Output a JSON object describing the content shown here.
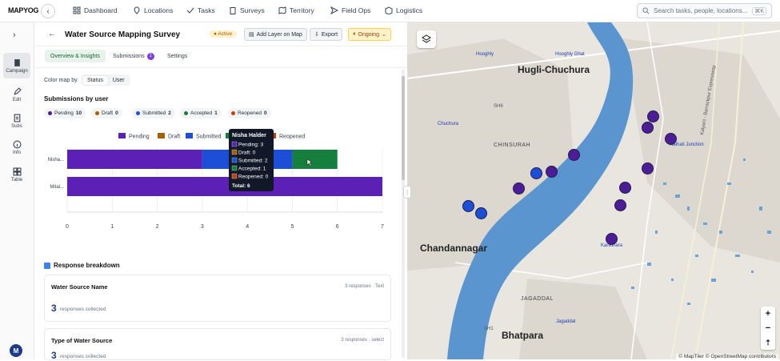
{
  "app": {
    "logo": "MAPYOG"
  },
  "nav": {
    "items": [
      {
        "label": "Dashboard",
        "icon": "dashboard-icon"
      },
      {
        "label": "Locations",
        "icon": "location-pin-icon"
      },
      {
        "label": "Tasks",
        "icon": "tasks-icon"
      },
      {
        "label": "Surveys",
        "icon": "clipboard-icon"
      },
      {
        "label": "Territory",
        "icon": "map-icon"
      },
      {
        "label": "Field Ops",
        "icon": "send-icon"
      },
      {
        "label": "Logistics",
        "icon": "box-icon"
      }
    ],
    "search_placeholder": "Search tasks, people, locations...",
    "search_shortcut": "⌘K"
  },
  "rail": {
    "items": [
      {
        "label": "Campaign",
        "icon": "clipboard-icon"
      },
      {
        "label": "Edit",
        "icon": "edit-icon"
      },
      {
        "label": "Subs",
        "icon": "document-icon"
      },
      {
        "label": "Info",
        "icon": "info-icon"
      },
      {
        "label": "Table",
        "icon": "table-icon"
      }
    ],
    "avatar": "M"
  },
  "survey": {
    "title": "Water Source Mapping Survey",
    "status": "Active",
    "buttons": {
      "add_layer": "Add Layer on Map",
      "export": "Export",
      "ongoing": "Ongoing"
    },
    "tabs": [
      {
        "label": "Overview & Insights"
      },
      {
        "label": "Submissions",
        "badge": "1"
      },
      {
        "label": "Settings"
      }
    ],
    "color_map_label": "Color map by",
    "color_map_options": [
      "Status",
      "User"
    ],
    "submissions_by_user": "Submissions by user",
    "chips": [
      {
        "label": "Pending",
        "count": "10",
        "color": "#4c1d95"
      },
      {
        "label": "Draft",
        "count": "0",
        "color": "#a16207"
      },
      {
        "label": "Submitted",
        "count": "2",
        "color": "#1d4ed8"
      },
      {
        "label": "Accepted",
        "count": "1",
        "color": "#15803d"
      },
      {
        "label": "Reopened",
        "count": "0",
        "color": "#c2410c"
      }
    ],
    "tooltip": {
      "name": "Nisha Halder",
      "rows": [
        "Pending: 3",
        "Draft: 0",
        "Submitted: 2",
        "Accepted: 1",
        "Reopened: 0"
      ],
      "total": "Total: 6"
    },
    "response_breakdown": "Response breakdown",
    "cards": [
      {
        "title": "Water Source Name",
        "meta": "3 responses · Text",
        "count": "3",
        "sub": "responses collected"
      },
      {
        "title": "Type of Water Source",
        "meta": "3 responses · select",
        "count": "3",
        "sub": "responses collected"
      }
    ]
  },
  "chart_data": {
    "type": "bar",
    "orientation": "horizontal",
    "stacked": true,
    "categories": [
      "Nisha...",
      "Mital..."
    ],
    "series": [
      {
        "name": "Pending",
        "values": [
          3,
          7
        ],
        "color": "#5b21b6"
      },
      {
        "name": "Draft",
        "values": [
          0,
          0
        ],
        "color": "#a16207"
      },
      {
        "name": "Submitted",
        "values": [
          2,
          0
        ],
        "color": "#1d4ed8"
      },
      {
        "name": "Accepted",
        "values": [
          1,
          0
        ],
        "color": "#15803d"
      },
      {
        "name": "Reopened",
        "values": [
          0,
          0
        ],
        "color": "#c2410c"
      }
    ],
    "xlim": [
      0,
      7
    ],
    "xticks": [
      "0",
      "1",
      "2",
      "3",
      "4",
      "5",
      "6",
      "7"
    ],
    "legend": "top",
    "grid": true
  },
  "map": {
    "labels": [
      {
        "text": "Hugli-Chuchura",
        "cls": "big"
      },
      {
        "text": "Chandannagar",
        "cls": "big"
      },
      {
        "text": "Bhatpara",
        "cls": "big"
      },
      {
        "text": "CHINSURAH",
        "cls": "med"
      },
      {
        "text": "JAGADDAL",
        "cls": "med"
      },
      {
        "text": "Hooghly",
        "cls": "blue"
      },
      {
        "text": "Hooghly Ghat",
        "cls": "blue"
      },
      {
        "text": "Chuchura",
        "cls": "blue"
      },
      {
        "text": "Naihati Junction",
        "cls": "blue"
      },
      {
        "text": "Kankinara",
        "cls": "blue"
      },
      {
        "text": "Jagaddal",
        "cls": "blue"
      },
      {
        "text": "SH6",
        "cls": ""
      },
      {
        "text": "SH1",
        "cls": ""
      },
      {
        "text": "Kalyani - Barrackpur Expressway",
        "cls": ""
      }
    ],
    "attribution": "© MapTiler © OpenStreetMap contributors",
    "zoom_in": "+",
    "zoom_out": "−"
  }
}
